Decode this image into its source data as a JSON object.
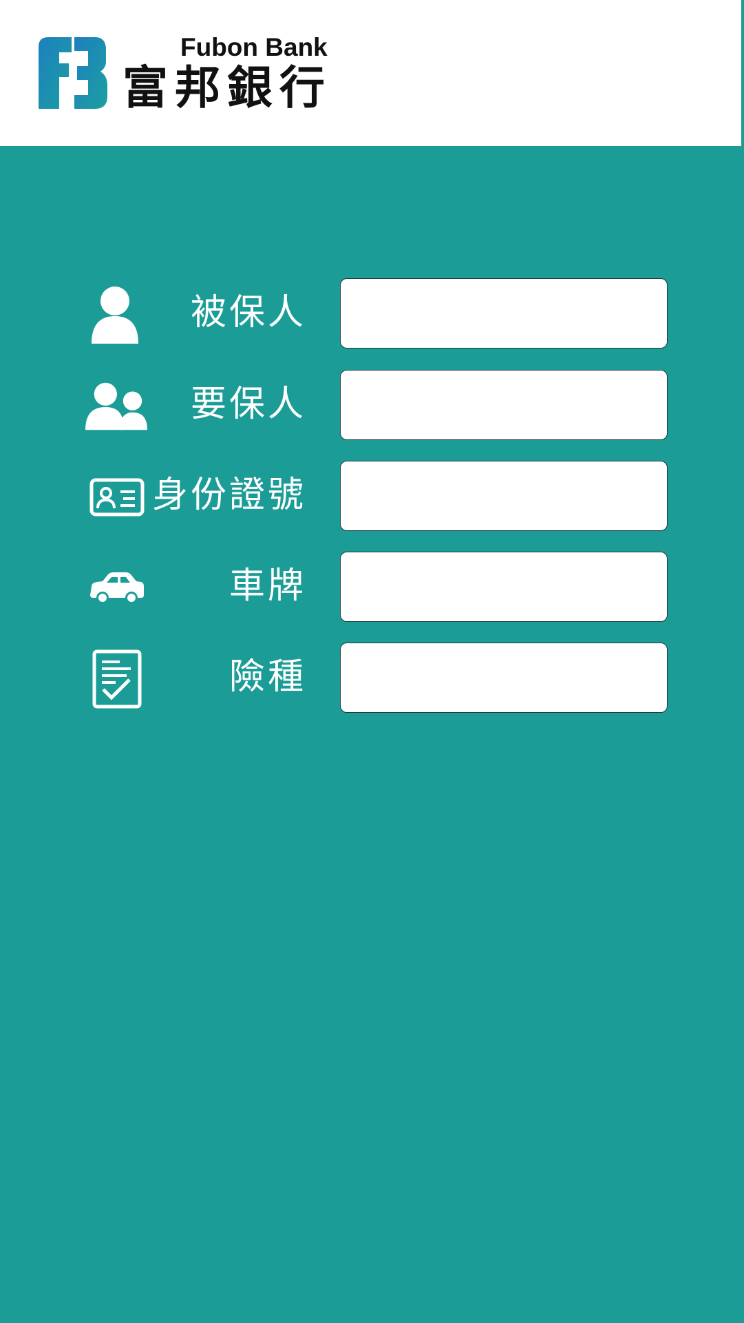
{
  "brand": {
    "name_en": "Fubon Bank",
    "name_zh": "富邦銀行",
    "logo_icon": "fubon-fb-logo",
    "colors": {
      "primary": "#1b9c96",
      "logo_blue": "#1e7fc0",
      "logo_teal": "#1aa0a0"
    }
  },
  "form": {
    "fields": [
      {
        "label": "被保人",
        "icon": "person-icon",
        "value": ""
      },
      {
        "label": "要保人",
        "icon": "people-icon",
        "value": ""
      },
      {
        "label": "身份證號",
        "icon": "id-card-icon",
        "value": ""
      },
      {
        "label": "車牌",
        "icon": "car-icon",
        "value": ""
      },
      {
        "label": "險種",
        "icon": "checklist-icon",
        "value": ""
      }
    ]
  }
}
